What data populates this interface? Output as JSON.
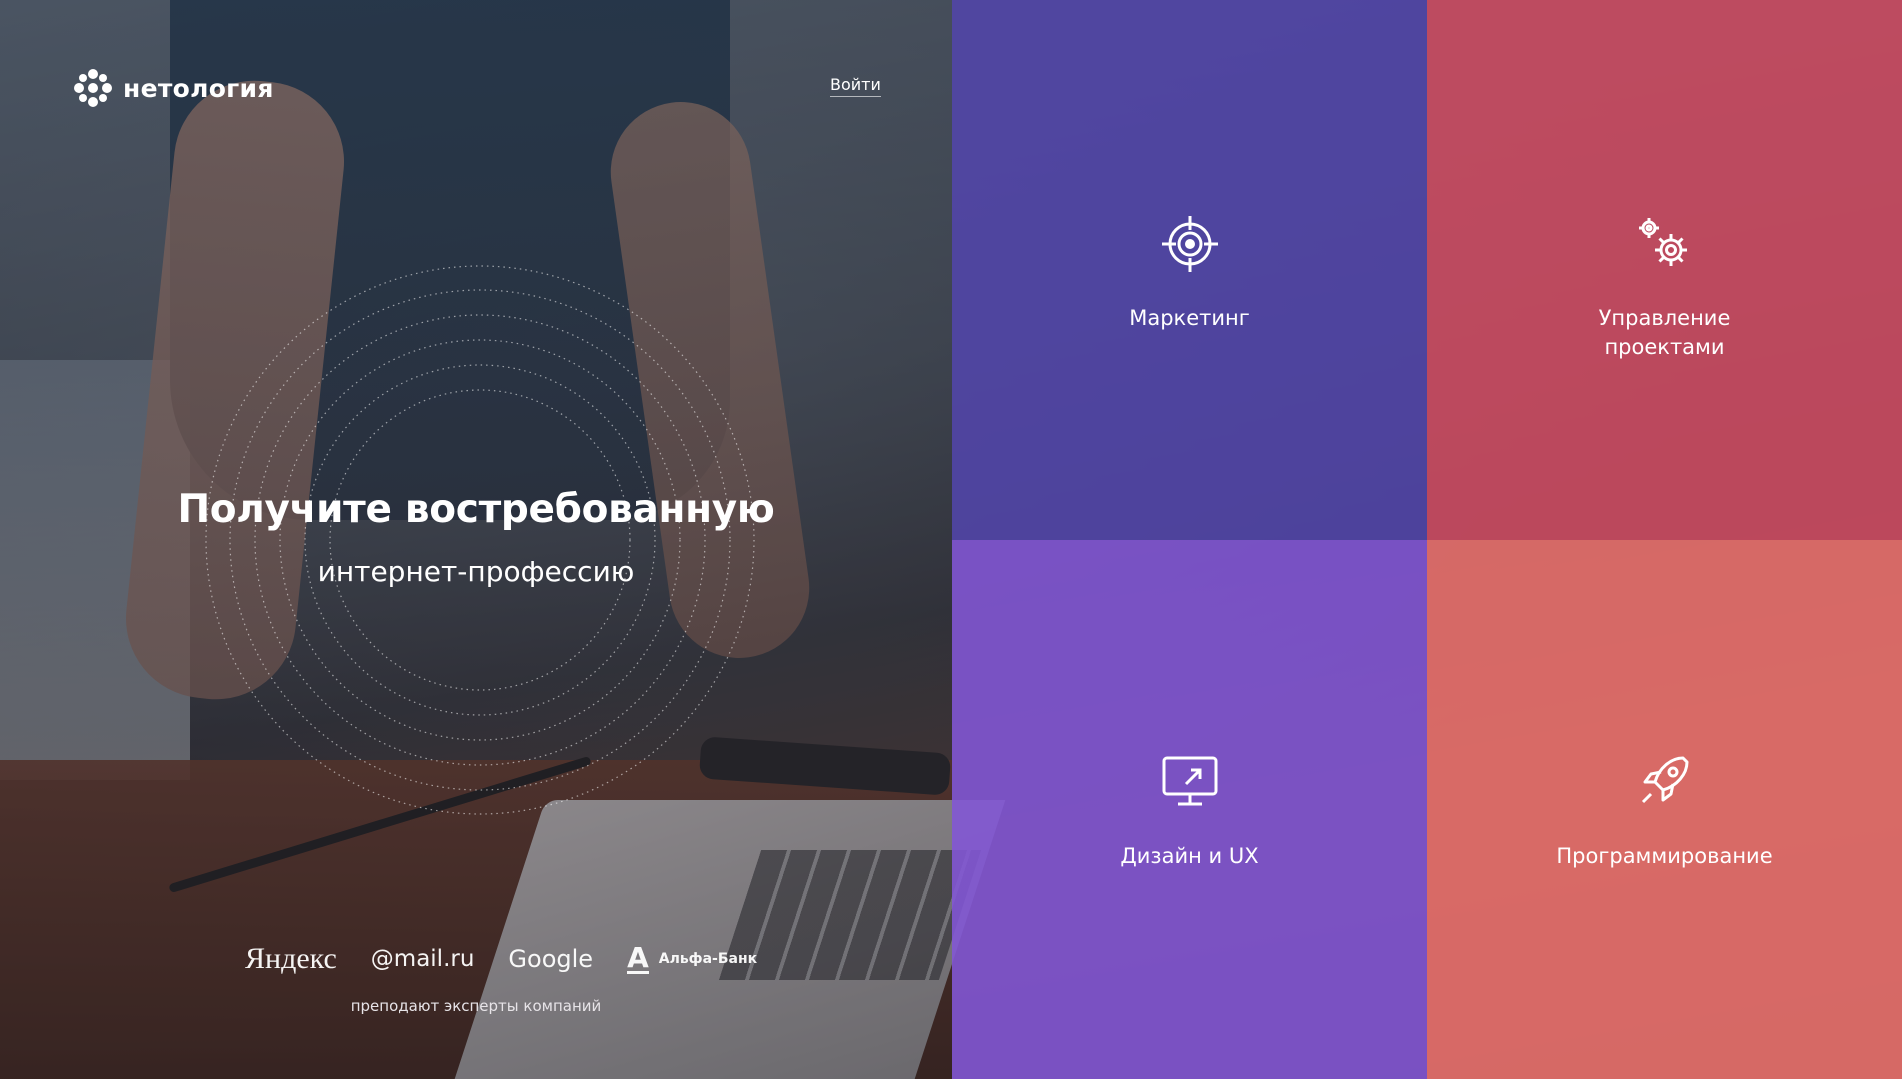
{
  "header": {
    "logo_icon": "snowflake-logo-icon",
    "logo_text": "нетология",
    "login_label": "Войти"
  },
  "hero": {
    "title": "Получите востребованную",
    "subtitle": "интернет-профессию"
  },
  "partners": {
    "logos": [
      "Яндекс",
      "@mail.ru",
      "Google",
      "Альфа-Банк"
    ],
    "caption": "преподают эксперты компаний"
  },
  "categories": [
    {
      "label_lines": [
        "Маркетинг"
      ],
      "icon": "target-icon",
      "color": "#5044a4"
    },
    {
      "label_lines": [
        "Управление",
        "проектами"
      ],
      "icon": "gears-icon",
      "color": "#c64a60"
    },
    {
      "label_lines": [
        "Дизайн и UX"
      ],
      "icon": "monitor-icon",
      "color": "#7e54ce"
    },
    {
      "label_lines": [
        "Программирование"
      ],
      "icon": "rocket-icon",
      "color": "#e26e6a"
    }
  ]
}
